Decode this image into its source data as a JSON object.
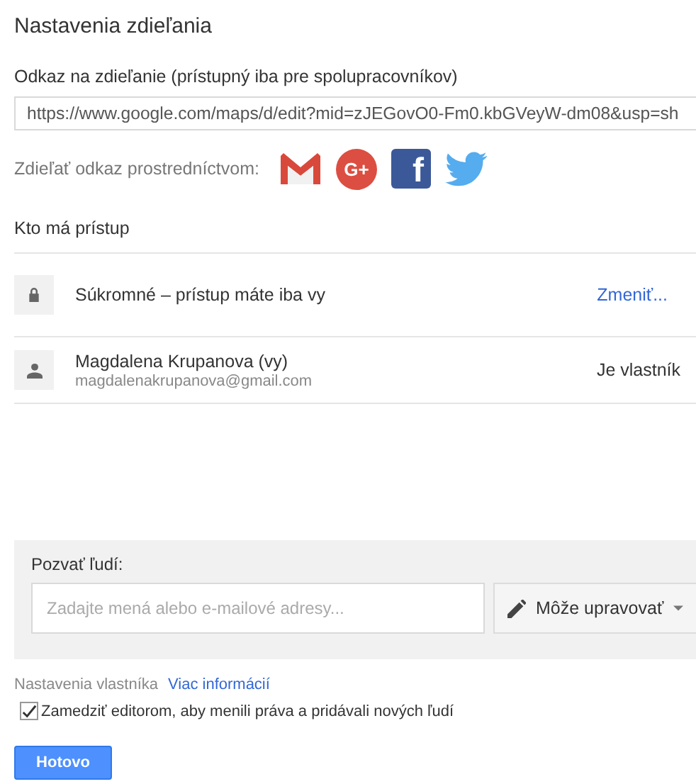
{
  "title": "Nastavenia zdieľania",
  "link": {
    "label": "Odkaz na zdieľanie (prístupný iba pre spolupracovníkov)",
    "value": "https://www.google.com/maps/d/edit?mid=zJEGovO0-Fm0.kbGVeyW-dm08&usp=sh"
  },
  "share_via": {
    "label": "Zdieľať odkaz prostredníctvom:",
    "services": [
      {
        "kind": "gmail"
      },
      {
        "kind": "gplus",
        "glyph": "G+"
      },
      {
        "kind": "facebook",
        "glyph": "f"
      },
      {
        "kind": "twitter"
      }
    ]
  },
  "access": {
    "heading": "Kto má prístup",
    "rows": [
      {
        "kind": "visibility",
        "title": "Súkromné – prístup máte iba vy",
        "action": "Zmeniť..."
      },
      {
        "kind": "person",
        "title": "Magdalena Krupanova (vy)",
        "subtitle": "magdalenakrupanova@gmail.com",
        "role": "Je vlastník"
      }
    ]
  },
  "invite": {
    "label": "Pozvať ľudí:",
    "placeholder": "Zadajte mená alebo e-mailové adresy...",
    "permission": "Môže upravovať"
  },
  "owner_settings": {
    "label": "Nastavenia vlastníka",
    "link": "Viac informácií",
    "option": {
      "label": "Zamedziť editorom, aby menili práva a pridávali nových ľudí",
      "checked": true
    }
  },
  "buttons": [
    "Hotovo"
  ]
}
